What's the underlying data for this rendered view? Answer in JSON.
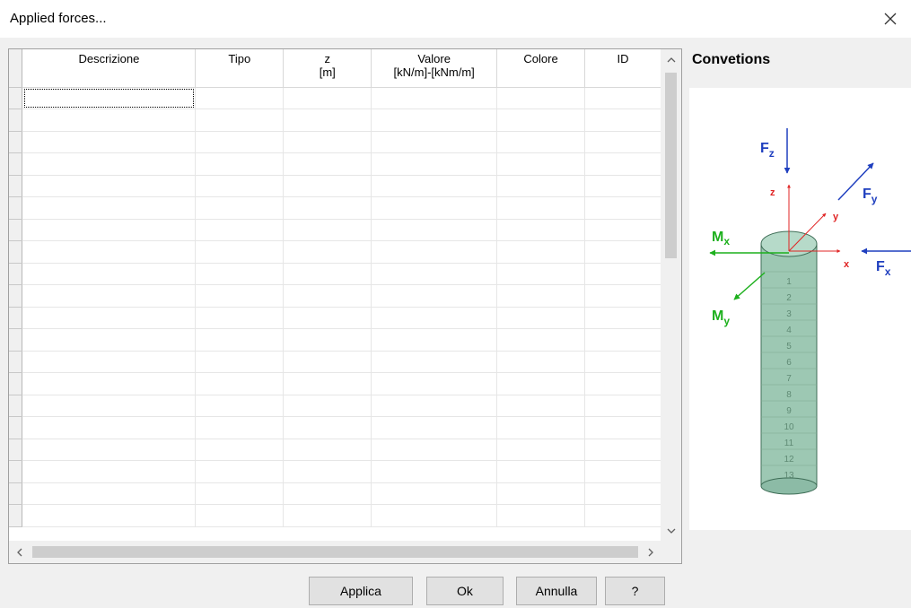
{
  "window": {
    "title": "Applied forces..."
  },
  "grid": {
    "columns": [
      {
        "label": "Descrizione",
        "sub": ""
      },
      {
        "label": "Tipo",
        "sub": ""
      },
      {
        "label": "z",
        "sub": "[m]"
      },
      {
        "label": "Valore",
        "sub": "[kN/m]-[kNm/m]"
      },
      {
        "label": "Colore",
        "sub": ""
      },
      {
        "label": "ID",
        "sub": ""
      }
    ],
    "row_count": 20
  },
  "convention": {
    "title": "Convetions",
    "labels": {
      "fz": "F",
      "fz_sub": "z",
      "fy": "F",
      "fy_sub": "y",
      "fx": "F",
      "fx_sub": "x",
      "mx": "M",
      "mx_sub": "x",
      "my": "M",
      "my_sub": "y",
      "axis_z": "z",
      "axis_y": "y",
      "axis_x": "x"
    },
    "segments": [
      "1",
      "2",
      "3",
      "4",
      "5",
      "6",
      "7",
      "8",
      "9",
      "10",
      "11",
      "12",
      "13"
    ],
    "colors": {
      "force": "#1f3fbf",
      "moment": "#1db01d",
      "axis": "#e02424",
      "pile": "#9dc8b3",
      "pile_stroke": "#3f6e57"
    }
  },
  "buttons": {
    "apply": "Applica",
    "ok": "Ok",
    "cancel": "Annulla",
    "help": "?"
  }
}
